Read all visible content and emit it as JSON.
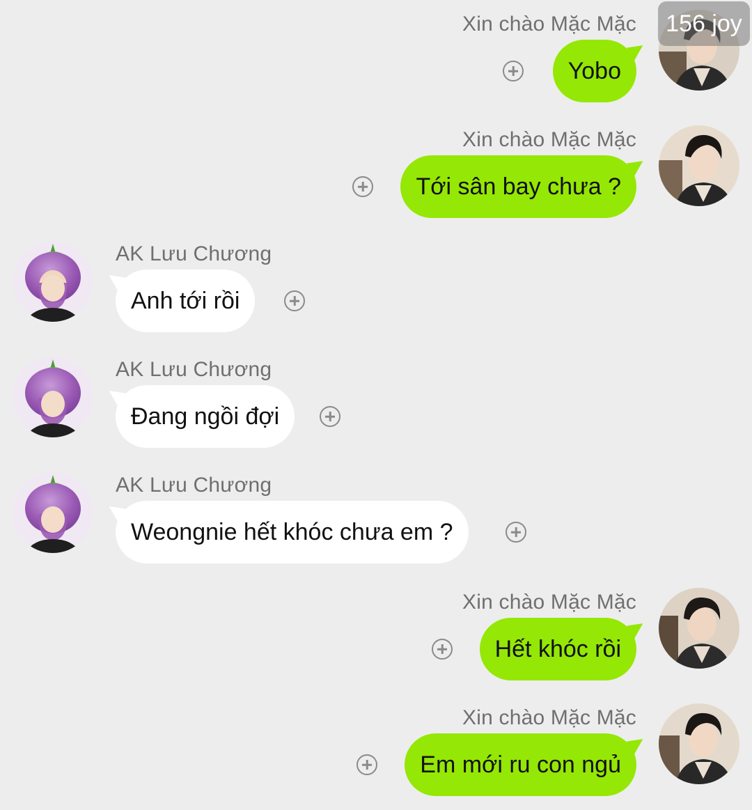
{
  "watermark": "156 joy",
  "messages": [
    {
      "side": "out",
      "sender": "Xin chào Mặc Mặc",
      "text": "Yobo",
      "avatar_icon": "dark-haired-man-avatar"
    },
    {
      "side": "out",
      "sender": "Xin chào Mặc Mặc",
      "text": "Tới sân bay chưa ?",
      "avatar_icon": "dark-haired-man-avatar"
    },
    {
      "side": "in",
      "sender": "AK Lưu Chương",
      "text": "Anh tới rồi",
      "avatar_icon": "eggplant-hat-boy-avatar"
    },
    {
      "side": "in",
      "sender": "AK Lưu Chương",
      "text": "Đang ngồi đợi",
      "avatar_icon": "eggplant-hat-boy-avatar"
    },
    {
      "side": "in",
      "sender": "AK Lưu Chương",
      "text": "Weongnie hết khóc chưa em ?",
      "avatar_icon": "eggplant-hat-boy-avatar"
    },
    {
      "side": "out",
      "sender": "Xin chào Mặc Mặc",
      "text": "Hết khóc rồi",
      "avatar_icon": "dark-haired-man-avatar"
    },
    {
      "side": "out",
      "sender": "Xin chào Mặc Mặc",
      "text": "Em mới ru con ngủ",
      "avatar_icon": "dark-haired-man-avatar"
    }
  ],
  "colors": {
    "background": "#ededed",
    "outgoing_bubble": "#95e705",
    "incoming_bubble": "#ffffff",
    "sender_name": "#6f6f6f",
    "eggplant_purple": "#9b5bb5"
  }
}
